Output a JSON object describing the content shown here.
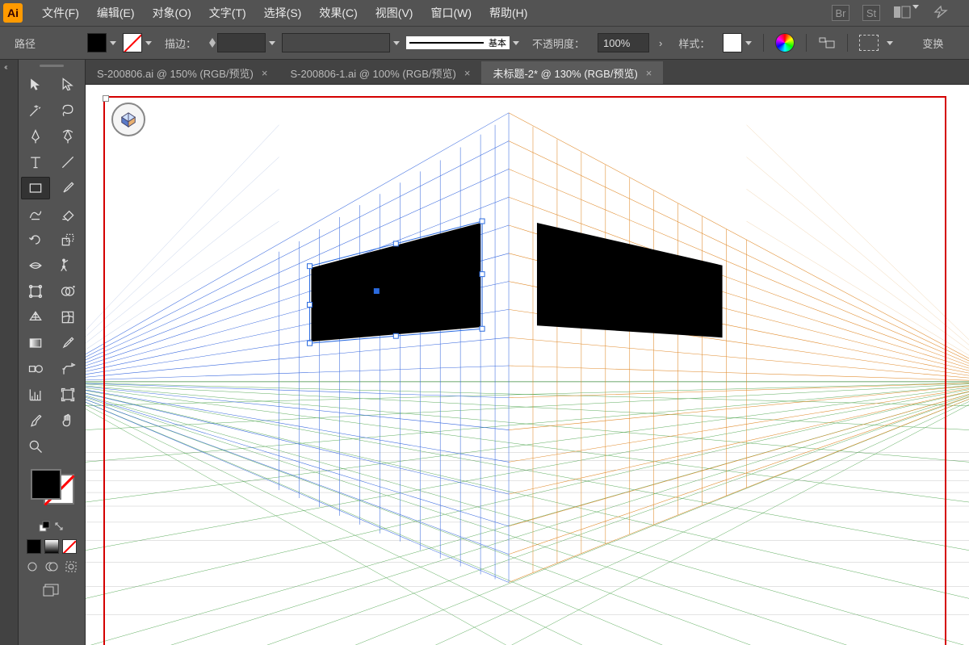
{
  "app": {
    "logo": "Ai"
  },
  "menu": {
    "file": "文件(F)",
    "edit": "编辑(E)",
    "object": "对象(O)",
    "type": "文字(T)",
    "select": "选择(S)",
    "effect": "效果(C)",
    "view": "视图(V)",
    "window": "窗口(W)",
    "help": "帮助(H)"
  },
  "menu_icons": {
    "br": "Br",
    "st": "St"
  },
  "control": {
    "mode_label": "路径",
    "stroke_label": "描边：",
    "stroke_width": "",
    "stroke_style": "基本",
    "opacity_label": "不透明度：",
    "opacity_value": "100%",
    "style_label": "样式：",
    "transform_label": "变换"
  },
  "tabs": [
    {
      "label": "S-200806.ai @ 150% (RGB/预览)",
      "active": false
    },
    {
      "label": "S-200806-1.ai @ 100% (RGB/预览)",
      "active": false
    },
    {
      "label": "未标题-2* @ 130% (RGB/预览)",
      "active": true
    }
  ],
  "colors": {
    "fill": "#000000",
    "stroke": "none"
  }
}
